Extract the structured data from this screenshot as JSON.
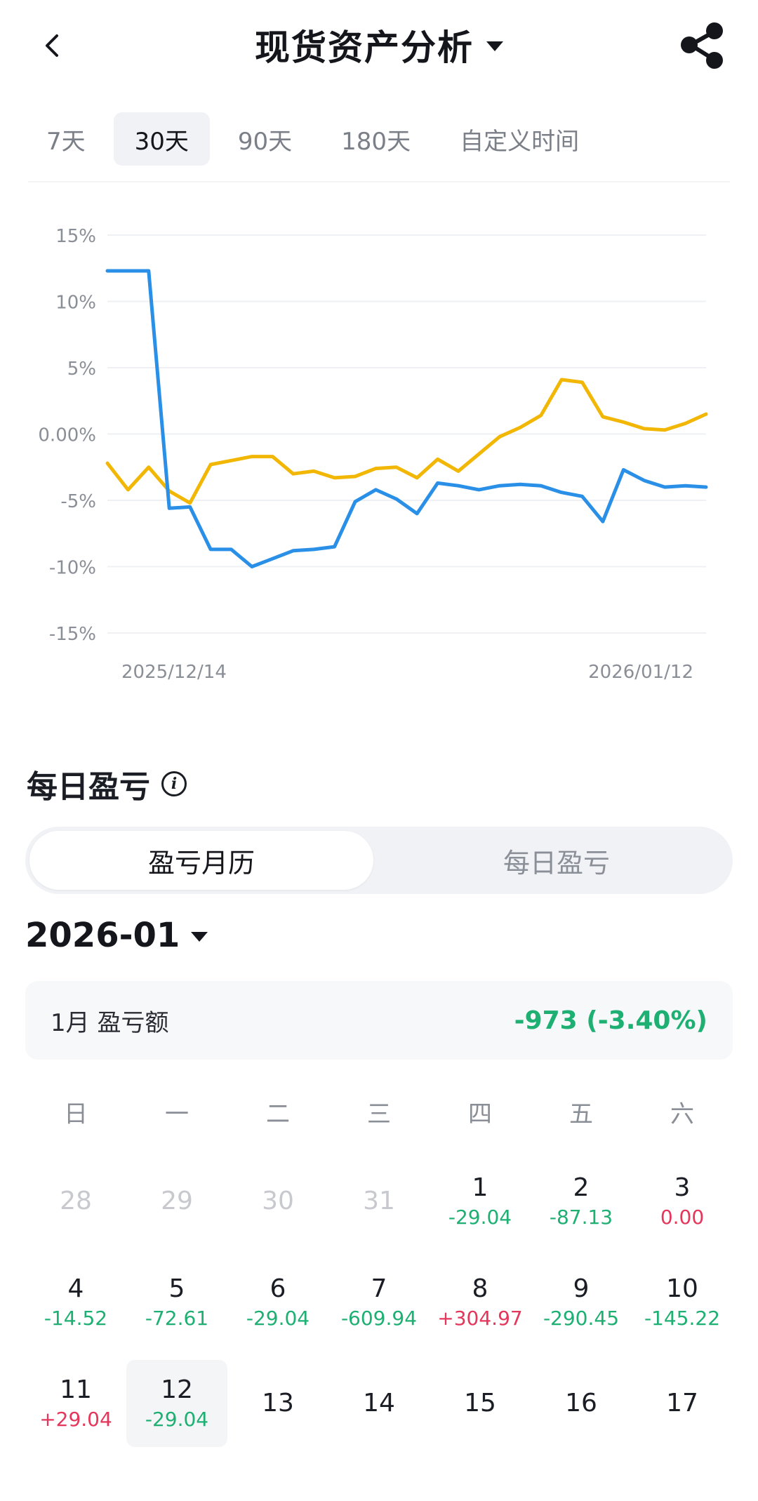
{
  "header": {
    "title": "现货资产分析"
  },
  "range_tabs": [
    {
      "label": "7天",
      "active": false
    },
    {
      "label": "30天",
      "active": true
    },
    {
      "label": "90天",
      "active": false
    },
    {
      "label": "180天",
      "active": false
    },
    {
      "label": "自定义时间",
      "active": false
    }
  ],
  "chart_data": {
    "type": "line",
    "y_ticks": [
      "15%",
      "10%",
      "5%",
      "0.00%",
      "-5%",
      "-10%",
      "-15%"
    ],
    "ylim": [
      -15,
      15
    ],
    "x_start_label": "2025/12/14",
    "x_end_label": "2026/01/12",
    "grid": true,
    "series": [
      {
        "color": "#f2b705",
        "values": [
          -2.2,
          -4.2,
          -2.5,
          -4.3,
          -5.2,
          -2.3,
          -2.0,
          -1.7,
          -1.7,
          -3.0,
          -2.8,
          -3.3,
          -3.2,
          -2.6,
          -2.5,
          -3.3,
          -1.9,
          -2.8,
          -1.5,
          -0.2,
          0.5,
          1.4,
          4.1,
          3.9,
          1.3,
          0.9,
          0.4,
          0.3,
          0.8,
          1.5
        ]
      },
      {
        "color": "#2a8fe6",
        "values": [
          12.3,
          12.3,
          12.3,
          -5.6,
          -5.5,
          -8.7,
          -8.7,
          -10.0,
          -9.4,
          -8.8,
          -8.7,
          -8.5,
          -5.1,
          -4.2,
          -4.9,
          -6.0,
          -3.7,
          -3.9,
          -4.2,
          -3.9,
          -3.8,
          -3.9,
          -4.4,
          -4.7,
          -6.6,
          -2.7,
          -3.5,
          -4.0,
          -3.9,
          -4.0
        ]
      }
    ]
  },
  "daily_pnl": {
    "title": "每日盈亏",
    "info_icon": "info-icon",
    "segments": {
      "left": "盈亏月历",
      "right": "每日盈亏"
    },
    "month": "2026-01",
    "summary_label": "1月 盈亏额",
    "summary_value": "-973 (-3.40%)",
    "weekdays": [
      "日",
      "一",
      "二",
      "三",
      "四",
      "五",
      "六"
    ],
    "weeks": [
      [
        {
          "day": "28",
          "muted": true
        },
        {
          "day": "29",
          "muted": true
        },
        {
          "day": "30",
          "muted": true
        },
        {
          "day": "31",
          "muted": true
        },
        {
          "day": "1",
          "pnl": "-29.04",
          "sign": "neg"
        },
        {
          "day": "2",
          "pnl": "-87.13",
          "sign": "neg"
        },
        {
          "day": "3",
          "pnl": "0.00",
          "sign": "pos"
        }
      ],
      [
        {
          "day": "4",
          "pnl": "-14.52",
          "sign": "neg"
        },
        {
          "day": "5",
          "pnl": "-72.61",
          "sign": "neg"
        },
        {
          "day": "6",
          "pnl": "-29.04",
          "sign": "neg"
        },
        {
          "day": "7",
          "pnl": "-609.94",
          "sign": "neg"
        },
        {
          "day": "8",
          "pnl": "+304.97",
          "sign": "pos"
        },
        {
          "day": "9",
          "pnl": "-290.45",
          "sign": "neg"
        },
        {
          "day": "10",
          "pnl": "-145.22",
          "sign": "neg"
        }
      ],
      [
        {
          "day": "11",
          "pnl": "+29.04",
          "sign": "pos"
        },
        {
          "day": "12",
          "pnl": "-29.04",
          "sign": "neg",
          "selected": true
        },
        {
          "day": "13"
        },
        {
          "day": "14"
        },
        {
          "day": "15"
        },
        {
          "day": "16"
        },
        {
          "day": "17"
        }
      ]
    ]
  }
}
